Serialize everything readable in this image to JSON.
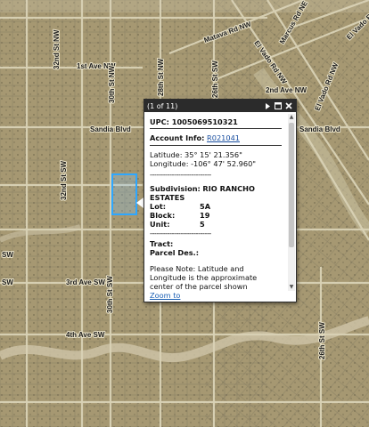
{
  "map": {
    "road_labels": {
      "matava": "Matava Rd NW",
      "marcus": "Marcus Rd NE",
      "el_vado_nw": "El Vado Rd NW",
      "first_ave_nw": "1st Ave NW",
      "second_ave_nw": "2nd Ave NW",
      "thirty_second_st_nw": "32nd St NW",
      "thirtieth_st_nw": "30th St NW",
      "twenty_eighth_st_nw": "28th St NW",
      "sandia_left": "Sandia Blvd",
      "sandia_right": "Sandia Blvd",
      "el_vado_right": "El Vado Rd NW",
      "thirty_second_st_sw": "32nd St SW",
      "third_ave_sw": "3rd Ave SW",
      "thirtieth_st_sw": "30th St SW",
      "fourth_ave_sw": "4th Ave SW",
      "twenty_sixth_st_sw": "26th St SW",
      "sw_left": "SW",
      "sw_left2": "SW",
      "el_vado_far": "El Vado Rd NW"
    },
    "parcel_highlight_color": "#2ea7ff"
  },
  "popup": {
    "count": "(1 of 11)",
    "header_icons": [
      "next-icon",
      "maximize-icon",
      "close-icon"
    ],
    "upc": "UPC: 1005069510321",
    "account_label": "Account Info:",
    "account_value": "R021041",
    "latitude": "Latitude: 35° 15' 21.356\"",
    "longitude": "Longitude: -106° 47' 52.960\"",
    "dashes": "----------------------------",
    "subdivision_label": "Subdivision:",
    "subdivision_value": "RIO RANCHO ESTATES",
    "lot_label": "Lot:",
    "lot_value": "5A",
    "block_label": "Block:",
    "block_value": "19",
    "unit_label": "Unit:",
    "unit_value": "5",
    "dashes2": "----------------------------",
    "tract_label": "Tract:",
    "parcel_des_label": "Parcel Des.:",
    "note": "Please Note: Latitude and Longitude is the approximate center of the parcel shown",
    "zoom_to": "Zoom to"
  }
}
